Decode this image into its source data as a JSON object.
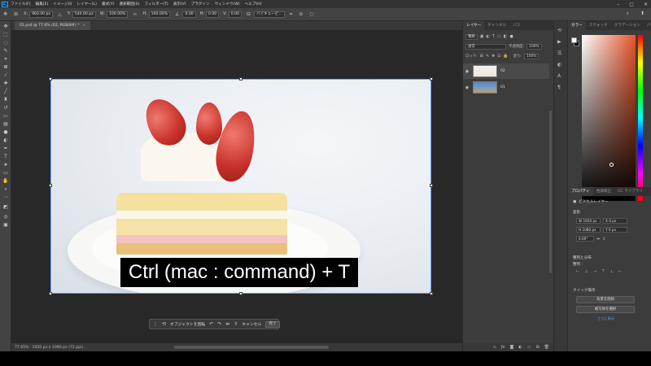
{
  "app": {
    "logo": "Ps",
    "menu": [
      "ファイル(F)",
      "編集(E)",
      "イメージ(I)",
      "レイヤー(L)",
      "書式(Y)",
      "選択範囲(S)",
      "フィルター(T)",
      "表示(V)",
      "プラグイン",
      "ウィンドウ(W)",
      "ヘルプ(H)"
    ],
    "window_controls": [
      "–",
      "▢",
      "✕"
    ]
  },
  "options": {
    "x_label": "X:",
    "x_value": "960.00 px",
    "y_label": "Y:",
    "y_value": "540.00 px",
    "w_label": "W:",
    "w_value": "100.00%",
    "h_label": "H:",
    "h_value": "100.00%",
    "angle_value": "0.00",
    "hskew_label": "H:",
    "hskew_value": "0.00",
    "vskew_label": "V:",
    "vskew_value": "0.00",
    "interp_value": "バイキュービ...",
    "cancel_symbol": "⊘",
    "commit_symbol": "○"
  },
  "document": {
    "tab_title": "01.psd @ 77.6% (02, RGB/8#) *",
    "tab_close": "×",
    "caption": "Ctrl (mac : command) + T"
  },
  "taskbar": {
    "rotate_label": "オブジェクトを回転",
    "cancel": "キャンセル",
    "done": "完了"
  },
  "status": {
    "zoom": "77.65%",
    "size": "1920 px x 1080 px (72 ppi)"
  },
  "layers_panel": {
    "tabs": [
      "レイヤー",
      "チャンネル",
      "パス"
    ],
    "filter_kind": "種類",
    "blend_mode": "通常",
    "opacity_label": "不透明度:",
    "opacity_value": "100%",
    "lock_label": "ロック:",
    "fill_label": "塗り:",
    "fill_value": "100%",
    "layers": [
      {
        "name": "02",
        "selected": true
      },
      {
        "name": "01",
        "selected": false
      }
    ]
  },
  "color_panel": {
    "tabs": [
      "カラー",
      "スウォッチ",
      "グラデーション",
      "パターン"
    ],
    "foreground": "#ffffff",
    "background": "#000000",
    "hue_color": "#e8542a"
  },
  "properties_panel": {
    "tabs": [
      "プロパティ",
      "色調補正",
      "CC ライブラリ"
    ],
    "layer_type": "ピクセルレイヤー",
    "transform_title": "変形",
    "w_value": "W 1920 px",
    "x_value": "X 0 px",
    "h_value": "H 1080 px",
    "y_value": "Y 0 px",
    "angle_value": "0.00°",
    "align_title": "整列と分布",
    "align_sub": "整列 :",
    "quick_title": "クイック操作",
    "remove_bg": "背景を削除",
    "select_subject": "被写体を選択",
    "more": "さらに表示"
  }
}
